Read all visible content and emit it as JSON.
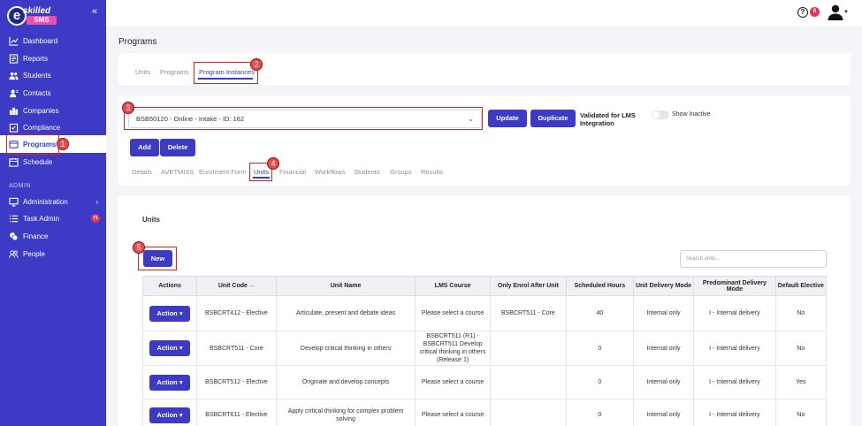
{
  "brand": {
    "letter": "e",
    "name": "skilled",
    "product": "SMS"
  },
  "sidebar": {
    "items": [
      {
        "label": "Dashboard"
      },
      {
        "label": "Reports"
      },
      {
        "label": "Students"
      },
      {
        "label": "Contacts"
      },
      {
        "label": "Companies"
      },
      {
        "label": "Compliance"
      },
      {
        "label": "Programs"
      },
      {
        "label": "Schedule"
      }
    ],
    "admin_label": "ADMIN",
    "admin_items": [
      {
        "label": "Administration"
      },
      {
        "label": "Task Admin",
        "badge": "71"
      },
      {
        "label": "Finance"
      },
      {
        "label": "People"
      }
    ]
  },
  "topbar": {
    "help": "?",
    "notifications": "8"
  },
  "page": {
    "title": "Programs"
  },
  "top_tabs": [
    "Units",
    "Programs",
    "Program Instances"
  ],
  "instance": {
    "selected": "BSB50120 - Online - Intake - ID: 162",
    "update_label": "Update",
    "duplicate_label": "Duplicate",
    "validated_label": "Validated for LMS Integration",
    "show_inactive_label": "Show Inactive",
    "add_label": "Add",
    "delete_label": "Delete"
  },
  "sub_tabs": [
    "Details",
    "AVETMISS",
    "Enrolment Form",
    "Units",
    "Financial",
    "Workflows",
    "Students",
    "Groups",
    "Results"
  ],
  "units": {
    "heading": "Units",
    "new_label": "New",
    "search_placeholder": "Search units...",
    "columns": [
      "Actions",
      "Unit Code",
      "Unit Name",
      "LMS Course",
      "Only Enrol After Unit",
      "Scheduled Hours",
      "Unit Delivery Mode",
      "Predominant Delivery Mode",
      "Default Elective"
    ],
    "action_label": "Action",
    "rows": [
      {
        "code": "BSBCRT412 - Elective",
        "name": "Articulate, present and debate ideas",
        "lms": "Please select a course",
        "after": "BSBCRT511 - Core",
        "hours": "40",
        "mode": "Internal only",
        "pred": "I - Internal delivery",
        "elective": "No"
      },
      {
        "code": "BSBCRT511 - Core",
        "name": "Develop critical thinking in others",
        "lms": "BSBCRT511 (R1) - BSBCRT511 Develop critical thinking in others (Release 1)",
        "after": "",
        "hours": "0",
        "mode": "Internal only",
        "pred": "I - Internal delivery",
        "elective": "No"
      },
      {
        "code": "BSBCRT512 - Elective",
        "name": "Originate and develop concepts",
        "lms": "Please select a course",
        "after": "",
        "hours": "0",
        "mode": "Internal only",
        "pred": "I - Internal delivery",
        "elective": "Yes"
      },
      {
        "code": "BSBCRT611 - Elective",
        "name": "Apply critical thinking for complex problem solving",
        "lms": "Please select a course",
        "after": "",
        "hours": "0",
        "mode": "Internal only",
        "pred": "I - Internal delivery",
        "elective": "No"
      }
    ]
  },
  "callouts": [
    "1",
    "2",
    "3",
    "4",
    "5"
  ]
}
